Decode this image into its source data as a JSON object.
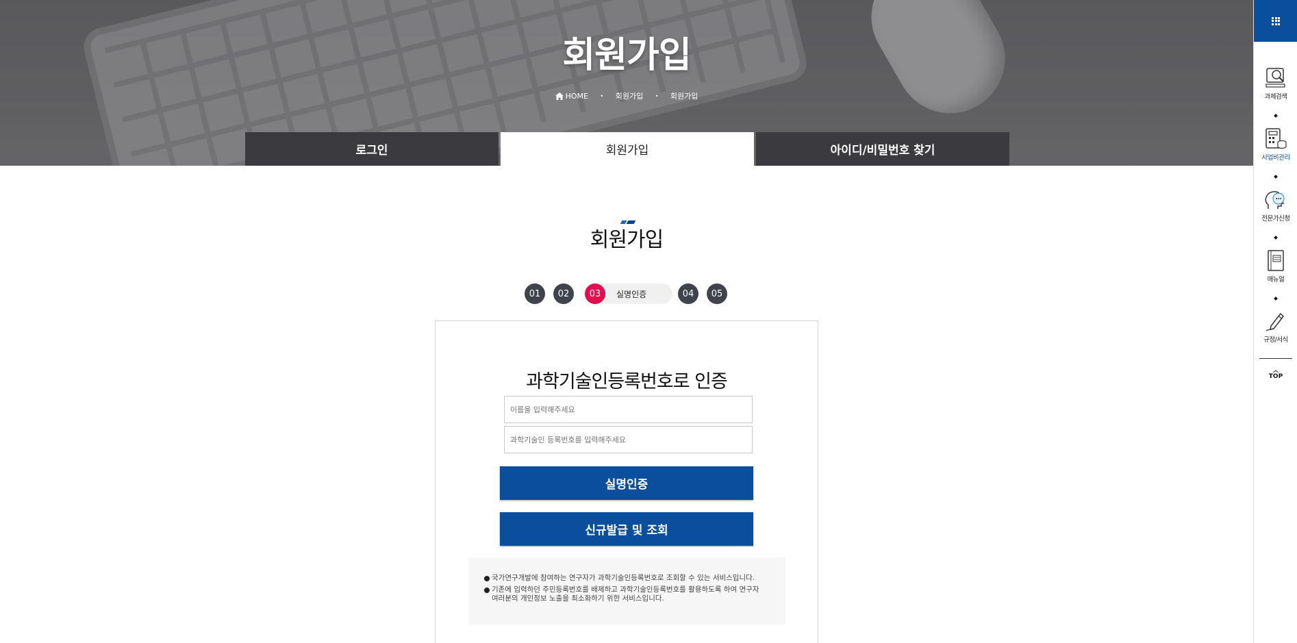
{
  "hero": {
    "title": "회원가입",
    "breadcrumb": [
      "HOME",
      "회원가입",
      "회원가입"
    ]
  },
  "tabs": [
    {
      "label": "로그인",
      "active": false
    },
    {
      "label": "회원가입",
      "active": true
    },
    {
      "label": "아이디/비밀번호 찾기",
      "active": false
    }
  ],
  "section": {
    "title": "회원가입"
  },
  "steps": {
    "items": [
      "01",
      "02",
      "03",
      "04",
      "05"
    ],
    "current_index": 2,
    "current_label": "실명인증"
  },
  "form": {
    "title": "과학기술인등록번호로 인증",
    "name_placeholder": "이름을 입력해주세요",
    "number_placeholder": "과학기술인 등록번호를 입력해주세요",
    "verify_button": "실명인증",
    "issue_button": "신규발급 및 조회",
    "notices": [
      "국가연구개발에 참여하는 연구자가 과학기술인등록번호로 조회할 수 있는 서비스입니다.",
      "기존에 입력하던 주민등록번호를 배제하고 과학기술인등록번호를 활용하도록 하여 연구자 여러분의 개인정보 노출을 최소화하기 위한 서비스입니다."
    ]
  },
  "quickbar": {
    "items": [
      {
        "label": "과제검색",
        "icon": "search-monitor-icon",
        "highlight": false
      },
      {
        "label": "사업비관리",
        "icon": "calculator-icon",
        "highlight": true
      },
      {
        "label": "전문가신청",
        "icon": "expert-icon",
        "highlight": false
      },
      {
        "label": "매뉴얼",
        "icon": "manual-icon",
        "highlight": false
      },
      {
        "label": "규정/서식",
        "icon": "pen-icon",
        "highlight": false
      }
    ],
    "top_label": "TOP"
  },
  "colors": {
    "primary": "#0a4f9e",
    "step_current": "#e10f4d",
    "step_default": "#3f434b",
    "tab_dark": "#3b3b3f"
  }
}
